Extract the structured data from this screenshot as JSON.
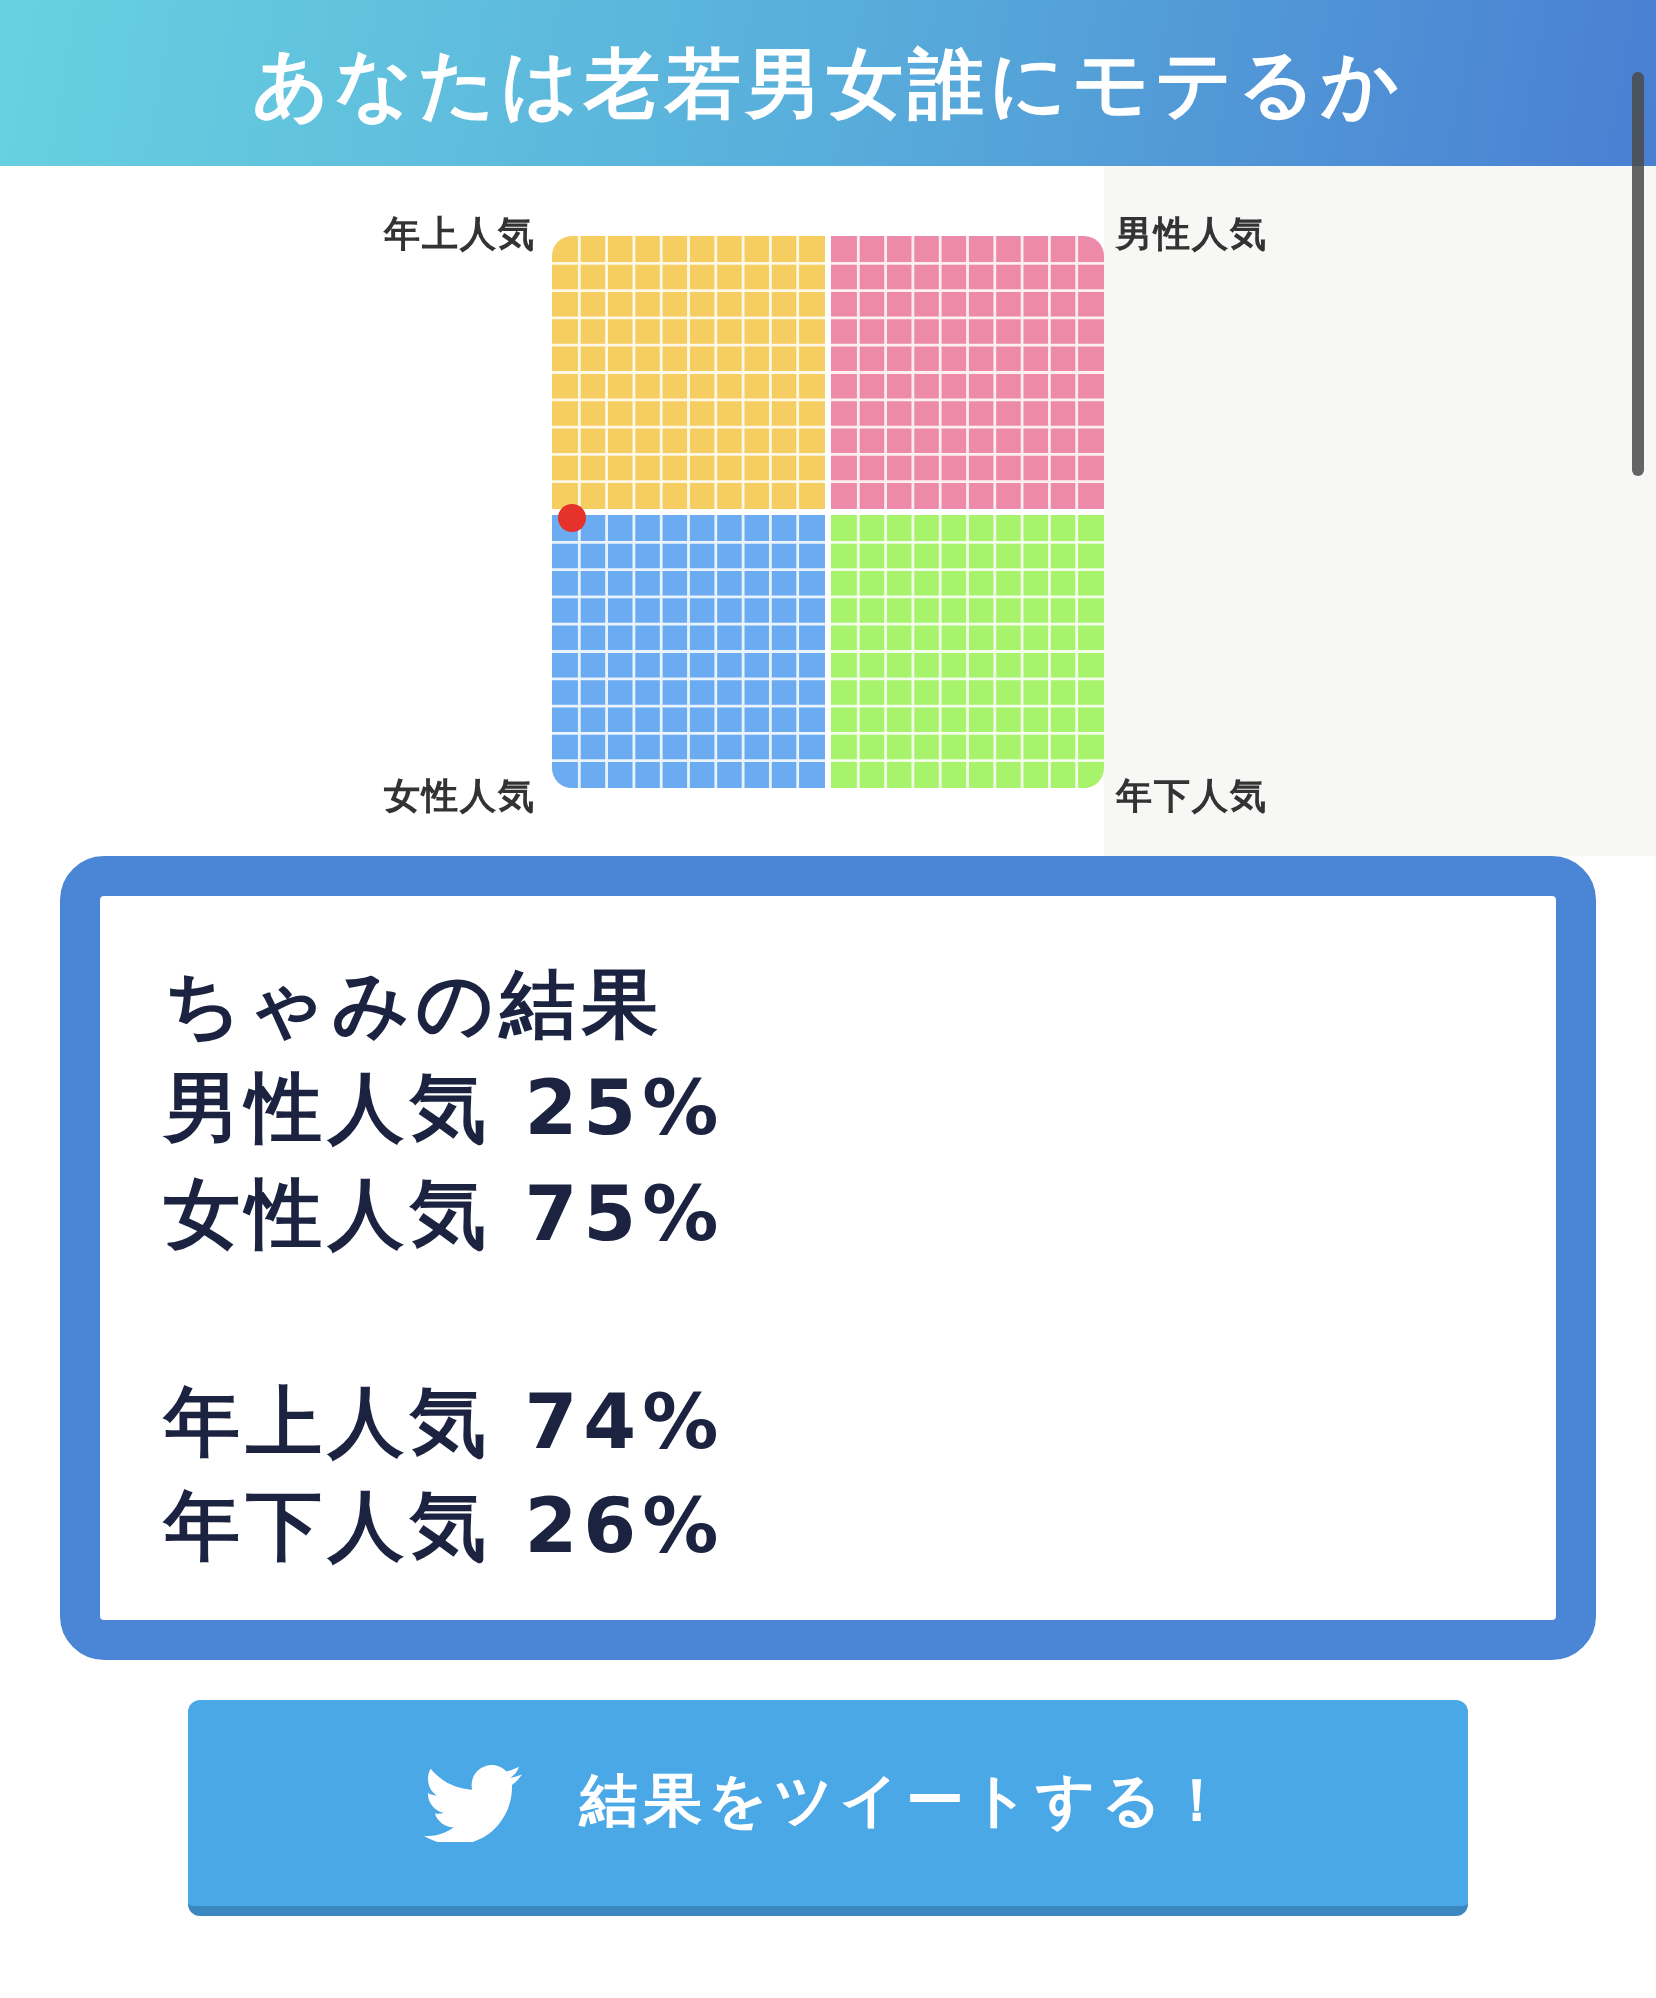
{
  "header": {
    "title": "あなたは老若男女誰にモテるか"
  },
  "chart": {
    "labels": {
      "top_left": "年上人気",
      "top_right": "男性人気",
      "bottom_left": "女性人気",
      "bottom_right": "年下人気"
    }
  },
  "result": {
    "title": "ちゃみの結果",
    "groups": [
      [
        "男性人気 25%",
        "女性人気 75%"
      ],
      [
        "年上人気 74%",
        "年下人気 26%"
      ]
    ]
  },
  "tweet_button": {
    "label": "結果をツイートする！"
  }
}
